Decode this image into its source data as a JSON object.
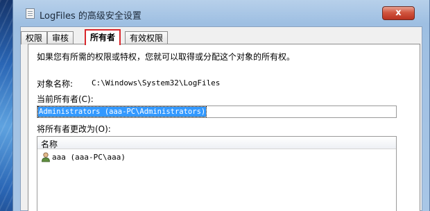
{
  "window": {
    "title": "LogFiles 的高级安全设置",
    "close_label": "x"
  },
  "tabs": [
    {
      "label": "权限",
      "active": false
    },
    {
      "label": "审核",
      "active": false
    },
    {
      "label": "所有者",
      "active": true
    },
    {
      "label": "有效权限",
      "active": false
    }
  ],
  "owner_panel": {
    "description": "如果您有所需的权限或特权，您就可以取得或分配这个对象的所有权。",
    "object_name_label": "对象名称:",
    "object_name_value": "C:\\Windows\\System32\\LogFiles",
    "current_owner_label": "当前所有者(C):",
    "current_owner_value": "Administrators (aaa-PC\\Administrators)",
    "change_owner_label": "将所有者更改为(O):",
    "list_header": "名称",
    "list_items": [
      {
        "name": "aaa (aaa-PC\\aaa)",
        "icon": "user-icon"
      }
    ]
  },
  "colors": {
    "highlight_tab_border": "#d9262b",
    "selection": "#3399ff",
    "close_button": "#c9442f"
  }
}
